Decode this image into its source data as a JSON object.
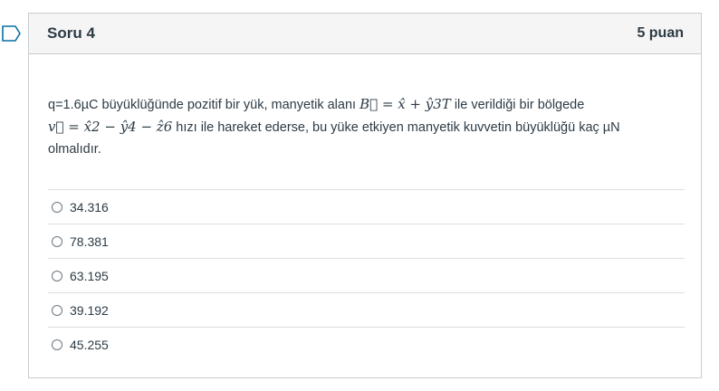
{
  "question": {
    "title": "Soru 4",
    "points": "5 puan",
    "text_line1_a": "q=1.6µC büyüklüğünde pozitif bir yük, manyetik alanı ",
    "math_b_field": "B⃗ = x̂ + ŷ3T",
    "text_line1_b": " ile verildiği bir bölgede",
    "math_velocity": "v⃗ = x̂2 − ŷ4 − ẑ6",
    "text_line2": " hızı ile hareket ederse, bu yüke etkiyen manyetik kuvvetin büyüklüğü kaç µN",
    "text_line3": "olmalıdır."
  },
  "answers": [
    {
      "label": "34.316"
    },
    {
      "label": "78.381"
    },
    {
      "label": "63.195"
    },
    {
      "label": "39.192"
    },
    {
      "label": "45.255"
    }
  ],
  "colors": {
    "header_bg": "#f5f5f5",
    "border": "#c7cdd1",
    "text": "#2d3b45",
    "flag": "#0770a3"
  },
  "icons": {
    "flag": "flag-question-icon"
  }
}
